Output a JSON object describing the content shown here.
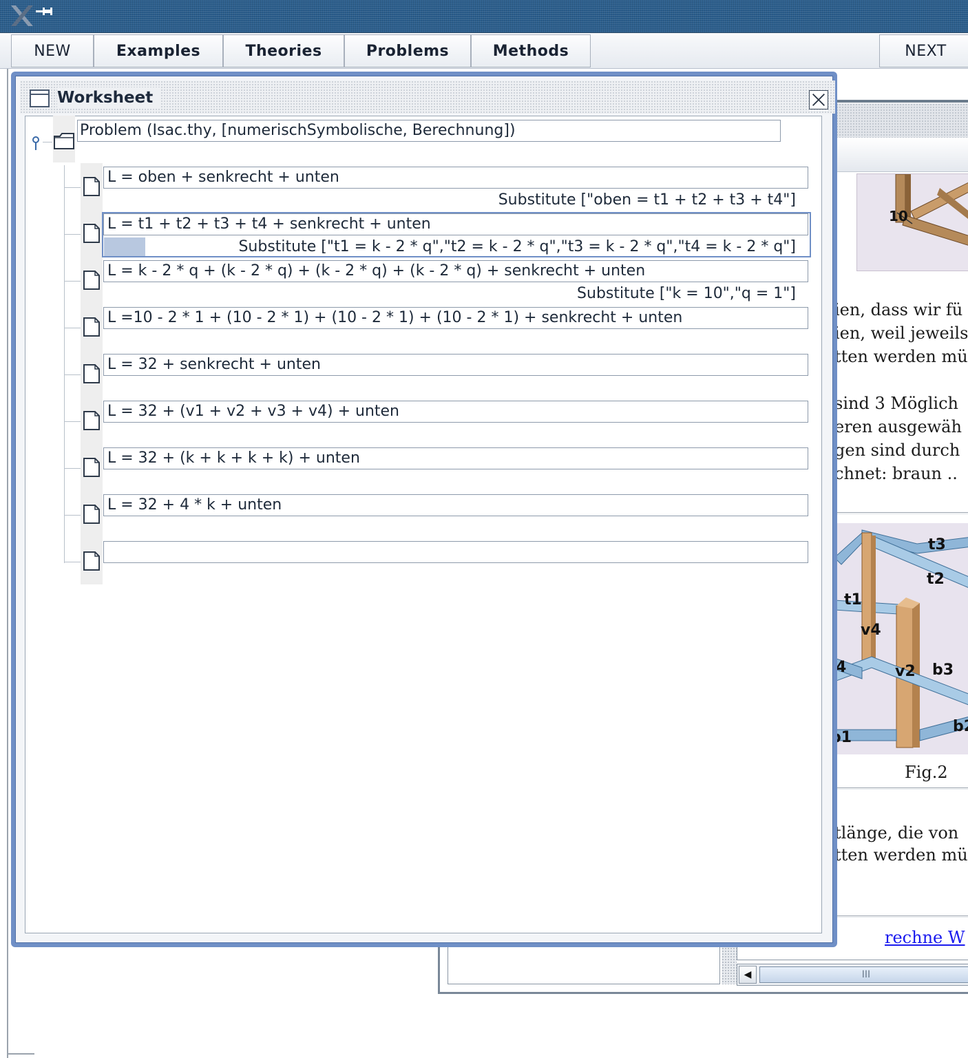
{
  "menubar": {
    "new_label": "NEW",
    "examples_label": "Examples",
    "theories_label": "Theories",
    "problems_label": "Problems",
    "methods_label": "Methods",
    "next_label": "NEXT"
  },
  "worksheet": {
    "title": "Worksheet",
    "problem": "Problem (Isac.thy, [numerischSymbolische, Berechnung])",
    "steps": [
      {
        "formula": "L = oben + senkrecht + unten",
        "tactic": "Substitute [\"oben = t1 + t2 + t3 + t4\"]"
      },
      {
        "formula": "L = t1 + t2 + t3 + t4 + senkrecht + unten",
        "tactic": "Substitute [\"t1 = k - 2 * q\",\"t2 = k - 2 * q\",\"t3 = k - 2 * q\",\"t4 = k - 2 * q\"]"
      },
      {
        "formula": "L = k - 2 * q + (k - 2 * q) + (k - 2 * q) + (k - 2 * q) + senkrecht + unten",
        "tactic": "Substitute [\"k = 10\",\"q = 1\"]"
      },
      {
        "formula": "L =10 - 2 * 1 + (10 - 2 * 1) + (10 - 2 * 1) + (10 - 2 * 1) + senkrecht + unten",
        "tactic": ""
      },
      {
        "formula": "L = 32 + senkrecht + unten",
        "tactic": ""
      },
      {
        "formula": "L = 32 + (v1 + v2 + v3 + v4) + unten",
        "tactic": ""
      },
      {
        "formula": "L = 32 + (k + k + k + k) + unten",
        "tactic": ""
      },
      {
        "formula": "L = 32 + 4 * k + unten",
        "tactic": ""
      },
      {
        "formula": "",
        "tactic": ""
      }
    ]
  },
  "background": {
    "fig1_label": "10",
    "text_lines_1": [
      "ien, dass wir fü",
      "ien, weil jeweils",
      "tten werden mü"
    ],
    "text_lines_2": [
      "sind 3 Möglich",
      "eren ausgewäh",
      "gen sind durch",
      "chnet: braun .."
    ],
    "fig2_labels": {
      "t3": "t3",
      "t2": "t2",
      "t1": "t1",
      "v4": "v4",
      "four": "4",
      "v2": "v2",
      "b3": "b3",
      "b2": "b2",
      "b1": "b1"
    },
    "fig2_caption": "Fig.2",
    "text_lines_3": [
      "tlänge, die von",
      "tten werden mü"
    ],
    "link": "rechne W",
    "scroll_thumb": "III",
    "scroll_left": "◀"
  },
  "colors": {
    "titlebar": "#2a5d8c",
    "worksheet_frame": "#6f8fc6",
    "link": "#1a1aee"
  }
}
